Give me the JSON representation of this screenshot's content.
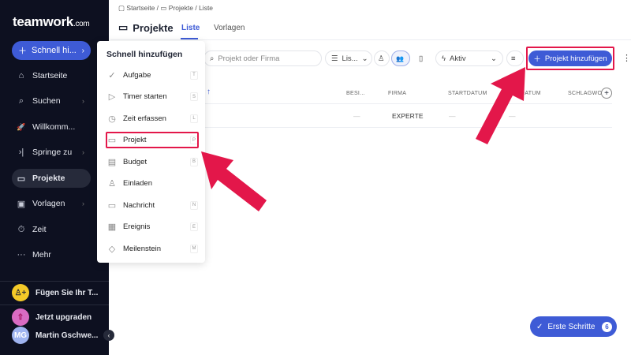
{
  "sidebar": {
    "logo": "teamwork",
    "logo_suffix": ".com",
    "quick_add": "Schnell hi...",
    "items": [
      {
        "label": "Startseite",
        "icon": "⌂"
      },
      {
        "label": "Suchen",
        "icon": "⌕"
      },
      {
        "label": "Willkomm...",
        "icon": "🚀"
      },
      {
        "label": "Springe zu",
        "icon": "›|"
      },
      {
        "label": "Projekte",
        "icon": "▭"
      },
      {
        "label": "Vorlagen",
        "icon": "▣"
      },
      {
        "label": "Zeit",
        "icon": "⏱"
      },
      {
        "label": "Mehr",
        "icon": "···"
      }
    ],
    "team": "Fügen Sie Ihr T...",
    "upgrade": "Jetzt upgraden",
    "user": "Martin Gschwe...",
    "user_initials": "MG"
  },
  "breadcrumb": [
    "Startseite",
    "Projekte",
    "Liste"
  ],
  "header": {
    "title": "Projekte",
    "tabs": [
      "Liste",
      "Vorlagen"
    ]
  },
  "toolbar": {
    "search_placeholder": "Projekt oder Firma",
    "view": "Lis...",
    "status": "Aktiv",
    "add_project": "Projekt hinzufügen"
  },
  "table": {
    "columns": [
      "BESI...",
      "FIRMA",
      "STARTDATUM",
      "DATUM",
      "SCHLAGWO"
    ],
    "row": {
      "owner": "—",
      "company": "EXPERTE",
      "start": "—",
      "end": "—"
    }
  },
  "popup": {
    "title": "Schnell hinzufügen",
    "items": [
      {
        "label": "Aufgabe",
        "key": "T",
        "icon": "✓"
      },
      {
        "label": "Timer starten",
        "key": "S",
        "icon": "▷"
      },
      {
        "label": "Zeit erfassen",
        "key": "L",
        "icon": "◷"
      },
      {
        "label": "Projekt",
        "key": "P",
        "icon": "▭"
      },
      {
        "label": "Budget",
        "key": "B",
        "icon": "▤"
      },
      {
        "label": "Einladen",
        "key": "",
        "icon": "♙"
      },
      {
        "label": "Nachricht",
        "key": "N",
        "icon": "▭"
      },
      {
        "label": "Ereignis",
        "key": "E",
        "icon": "▦"
      },
      {
        "label": "Meilenstein",
        "key": "M",
        "icon": "◇"
      }
    ]
  },
  "help": {
    "label": "Erste Schritte",
    "count": "6"
  },
  "colors": {
    "accent": "#3e5bd6",
    "sidebar": "#0d1020",
    "highlight": "#e3174a"
  }
}
